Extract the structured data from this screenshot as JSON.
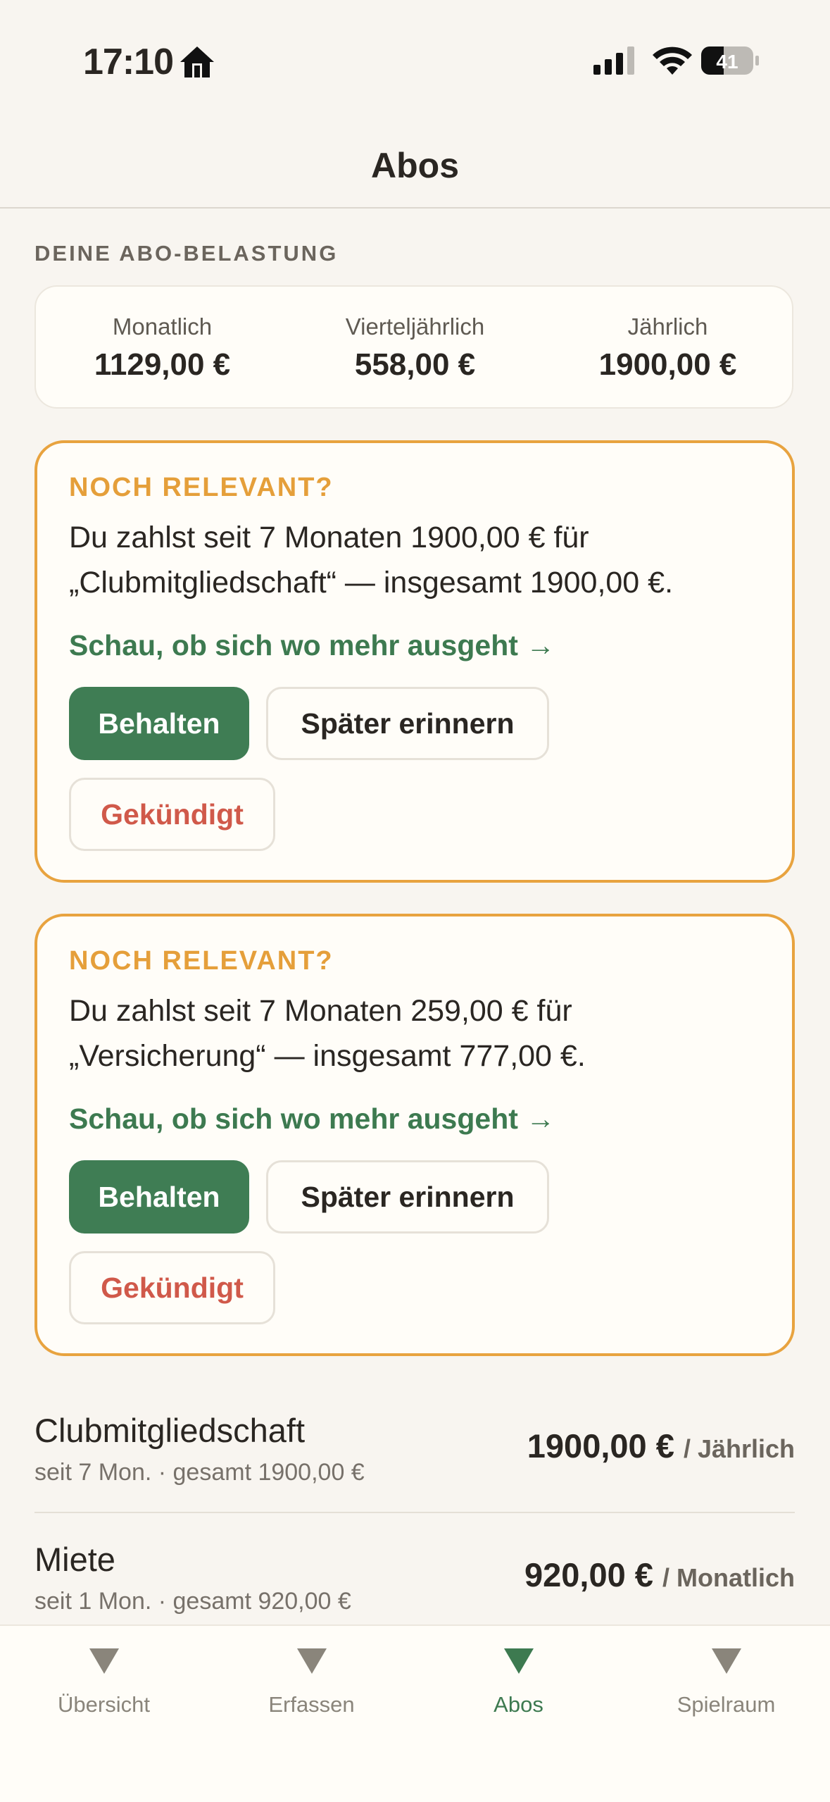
{
  "status_bar": {
    "time": "17:10",
    "battery": "41"
  },
  "nav": {
    "title": "Abos"
  },
  "summary": {
    "section_label": "DEINE ABO-BELASTUNG",
    "items": [
      {
        "label": "Monatlich",
        "value": "1129,00 €"
      },
      {
        "label": "Vierteljährlich",
        "value": "558,00 €"
      },
      {
        "label": "Jährlich",
        "value": "1900,00 €"
      }
    ]
  },
  "cards": [
    {
      "kicker": "NOCH RELEVANT?",
      "text": "Du zahlst seit 7 Monaten 1900,00 € für „Clubmitgliedschaft“ — insgesamt 1900,00 €.",
      "link": "Schau, ob sich wo mehr ausgeht →",
      "keep": "Behalten",
      "later": "Später erinnern",
      "cancelled": "Gekündigt"
    },
    {
      "kicker": "NOCH RELEVANT?",
      "text": "Du zahlst seit 7 Monaten 259,00 € für „Versicherung“ — insgesamt 777,00 €.",
      "link": "Schau, ob sich wo mehr ausgeht →",
      "keep": "Behalten",
      "later": "Später erinnern",
      "cancelled": "Gekündigt"
    }
  ],
  "subscriptions": [
    {
      "name": "Clubmitgliedschaft",
      "sub": "seit 7 Mon. · gesamt 1900,00 €",
      "price": "1900,00 €",
      "period": "/ Jährlich"
    },
    {
      "name": "Miete",
      "sub": "seit 1 Mon. · gesamt 920,00 €",
      "price": "920,00 €",
      "period": "/ Monatlich"
    }
  ],
  "tabs": [
    {
      "label": "Übersicht",
      "icon": "triangle-down-icon"
    },
    {
      "label": "Erfassen",
      "icon": "triangle-down-icon"
    },
    {
      "label": "Abos",
      "icon": "triangle-down-icon",
      "active": true
    },
    {
      "label": "Spielraum",
      "icon": "triangle-down-icon"
    }
  ],
  "colors": {
    "accent_green": "#3f7d54",
    "warning_orange": "#e8a33f",
    "danger_red": "#d0594a",
    "background": "#f8f5f0"
  }
}
